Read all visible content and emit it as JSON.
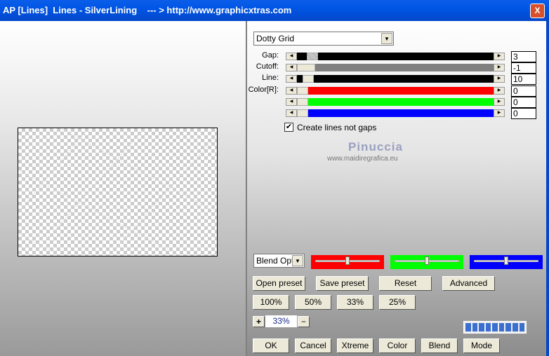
{
  "window": {
    "title": "AP [Lines]  Lines - SilverLining    --- > http://www.graphicxtras.com",
    "close": "X"
  },
  "preset_combo": {
    "value": "Dotty Grid"
  },
  "sliders": [
    {
      "label": "Gap:",
      "value": "3",
      "fill": "#000000"
    },
    {
      "label": "Cutoff:",
      "value": "-1",
      "fill": "#808080"
    },
    {
      "label": "Line:",
      "value": "10",
      "fill": "#000000"
    },
    {
      "label": "Color[R]:",
      "value": "0",
      "fill": "#ff0000"
    },
    {
      "label": "",
      "value": "0",
      "fill": "#00ff00"
    },
    {
      "label": "",
      "value": "0",
      "fill": "#0000ff"
    }
  ],
  "checkbox": {
    "label": "Create lines not gaps",
    "checked": true
  },
  "watermark": {
    "name": "Pinuccia",
    "url": "www.maidiregrafica.eu"
  },
  "blend": {
    "value": "Blend Optio",
    "swatches": [
      "#ff0000",
      "#00ff00",
      "#0000ff"
    ],
    "levels": [
      0.5,
      0.5,
      0.5
    ]
  },
  "buttons": {
    "open": "Open preset",
    "save": "Save preset",
    "reset": "Reset",
    "advanced": "Advanced",
    "z100": "100%",
    "z50": "50%",
    "z33": "33%",
    "z25": "25%",
    "ok": "OK",
    "cancel": "Cancel",
    "xtreme": "Xtreme",
    "color": "Color",
    "blend": "Blend",
    "mode": "Mode"
  },
  "zoom": {
    "plus": "+",
    "value": "33%",
    "minus": "−"
  },
  "progress": {
    "segments": 9
  }
}
